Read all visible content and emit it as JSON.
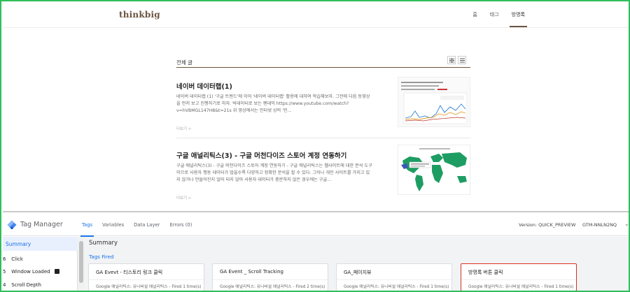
{
  "blog": {
    "logo": "thinkbig",
    "nav": [
      "홈",
      "태그",
      "방명록"
    ],
    "list_title": "전체 글",
    "view_icons": [
      "grid-icon",
      "list-icon"
    ],
    "posts": [
      {
        "title": "네이버 데이터랩(1)",
        "summary": "네이버 데이터랩 (1) '구글 트렌드'에 이어 '네이버 데이터랩' 활용에 대하여 학습해보자. 그전에 다음 동영상을 먼저 보고 진행하기로 하자. 빅데이터로 보는 팬데믹 https://www.youtube.com/watch?v=hVBMGL147H8&t=21s 위 영상에서는 인터넷 상의 '언...",
        "more": "더보기 >"
      },
      {
        "title": "구글 애널리틱스(3) - 구글 머천다이즈 스토어 계정 연동하기",
        "summary": "구글 애널리틱스(3) - 구글 머천다이즈 스토어 계정 연동하기 - 구글 애널리틱스는 웹사이트에 대한 분석 도구이므로 사용자 행동 데이터가 많을수록 다양하고 정확한 분석을 할 수 있다. 그러나 개인 사이트를 가지고 있지 않거나 만들어진지 얼마 되지 않아 사용자 데이터가 충분하지 않은 경우에는 구글...",
        "more": "더보기 >"
      }
    ]
  },
  "gtm": {
    "brand": "Tag Manager",
    "tabs": [
      "Tags",
      "Variables",
      "Data Layer",
      "Errors (0)"
    ],
    "version": "Version: QUICK_PREVIEW",
    "container_id": "GTM-NNLN2NQ",
    "sidebar": {
      "summary": "Summary",
      "items": [
        {
          "num": "6",
          "label": "Click"
        },
        {
          "num": "5",
          "label": "Window Loaded"
        },
        {
          "num": "4",
          "label": "Scroll Depth"
        }
      ]
    },
    "main": {
      "title": "Summary",
      "section": "Tags Fired",
      "cards": [
        {
          "name": "GA Evevt - 티스토리 링크 클릭",
          "desc": "Google 애널리틱스: 유니버설 애널리틱스 - Fired 1 time(s)"
        },
        {
          "name": "GA Event _ Scroll Tracking",
          "desc": "Google 애널리틱스: 유니버설 애널리틱스 - Fired 2 time(s)"
        },
        {
          "name": "GA_페이지뷰",
          "desc": "Google 애널리틱스: 유니버설 애널리틱스 - Fired 1 time(s)"
        },
        {
          "name": "방명록 버튼 클릭",
          "desc": "Google 애널리틱스: 유니버설 애널리틱스 - Fired 1 time(s)"
        }
      ]
    }
  },
  "colors": {
    "frame_border": "#2fbf5a",
    "blog_brown": "#6b5440",
    "gtm_blue": "#1a73e8",
    "highlight_red": "#d93025"
  }
}
